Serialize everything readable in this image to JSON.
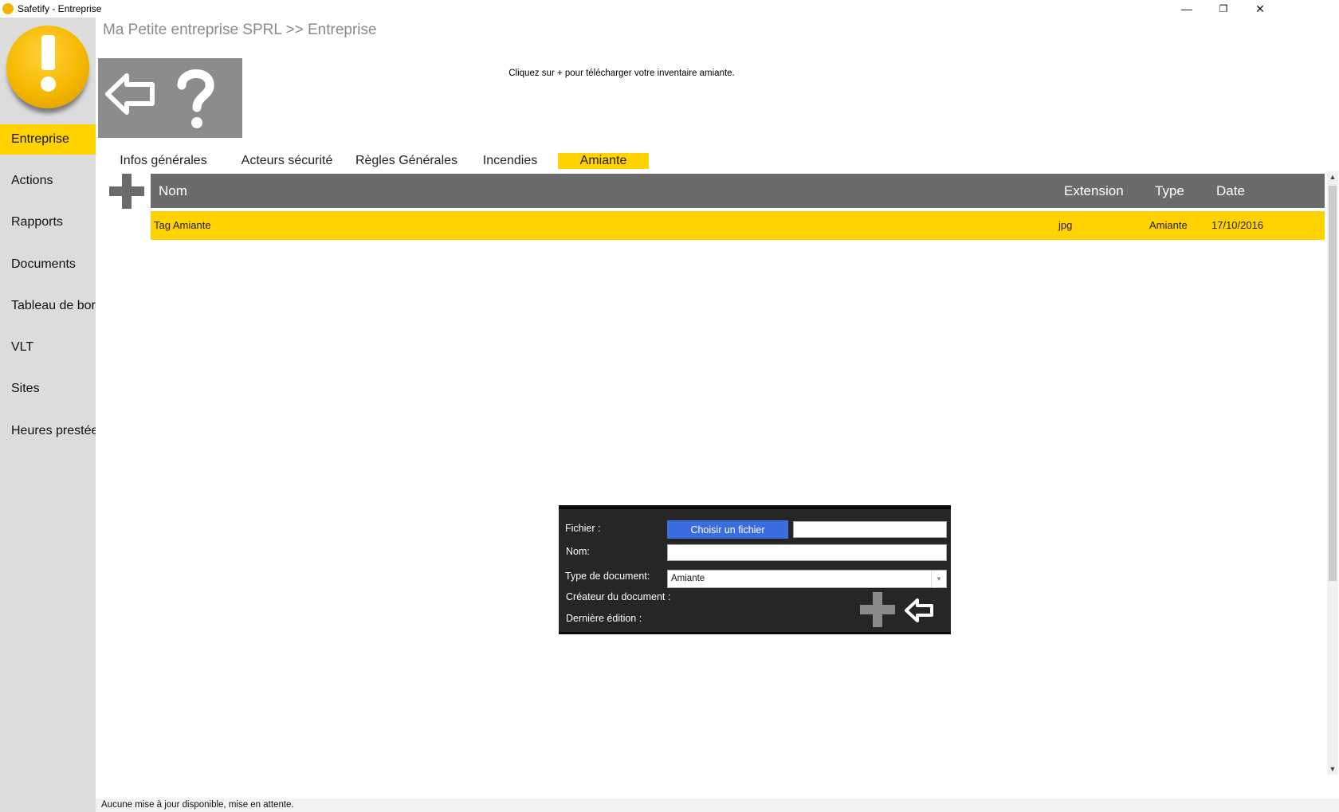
{
  "window": {
    "title": "Safetify - Entreprise",
    "controls": {
      "minimize": "—",
      "restore": "❐",
      "close": "✕"
    }
  },
  "sidebar": {
    "items": [
      {
        "label": "Entreprise",
        "active": true
      },
      {
        "label": "Actions"
      },
      {
        "label": "Rapports"
      },
      {
        "label": "Documents"
      },
      {
        "label": "Tableau de bor"
      },
      {
        "label": "VLT"
      },
      {
        "label": "Sites"
      },
      {
        "label": "Heures prestée"
      }
    ]
  },
  "breadcrumb": "Ma Petite entreprise SPRL >> Entreprise",
  "toolbar": {
    "back_icon": "back-arrow-icon",
    "help_icon": "question-mark-icon"
  },
  "hint": "Cliquez sur + pour télécharger votre inventaire amiante.",
  "tabs": [
    {
      "label": "Infos générales"
    },
    {
      "label": "Acteurs sécurité"
    },
    {
      "label": "Règles Générales"
    },
    {
      "label": "Incendies"
    },
    {
      "label": "Amiante",
      "active": true
    }
  ],
  "table": {
    "columns": {
      "nom": "Nom",
      "extension": "Extension",
      "type": "Type",
      "date": "Date"
    },
    "rows": [
      {
        "nom": "Tag Amiante",
        "extension": "jpg",
        "type": "Amiante",
        "date": "17/10/2016"
      }
    ]
  },
  "dialog": {
    "fichier_label": "Fichier :",
    "choose_button": "Choisir un fichier",
    "fichier_value": "",
    "nom_label": "Nom:",
    "nom_value": "",
    "type_label": "Type de document:",
    "type_value": "Amiante",
    "createur_label": "Créateur du document :",
    "derniere_label": "Dernière édition :"
  },
  "status": "Aucune mise à jour disponible, mise en attente.",
  "colors": {
    "accent": "#ffd200",
    "header": "#6b6b6b",
    "sidebar": "#dcdcdc",
    "button": "#3a6de0",
    "dialog": "#262626"
  }
}
